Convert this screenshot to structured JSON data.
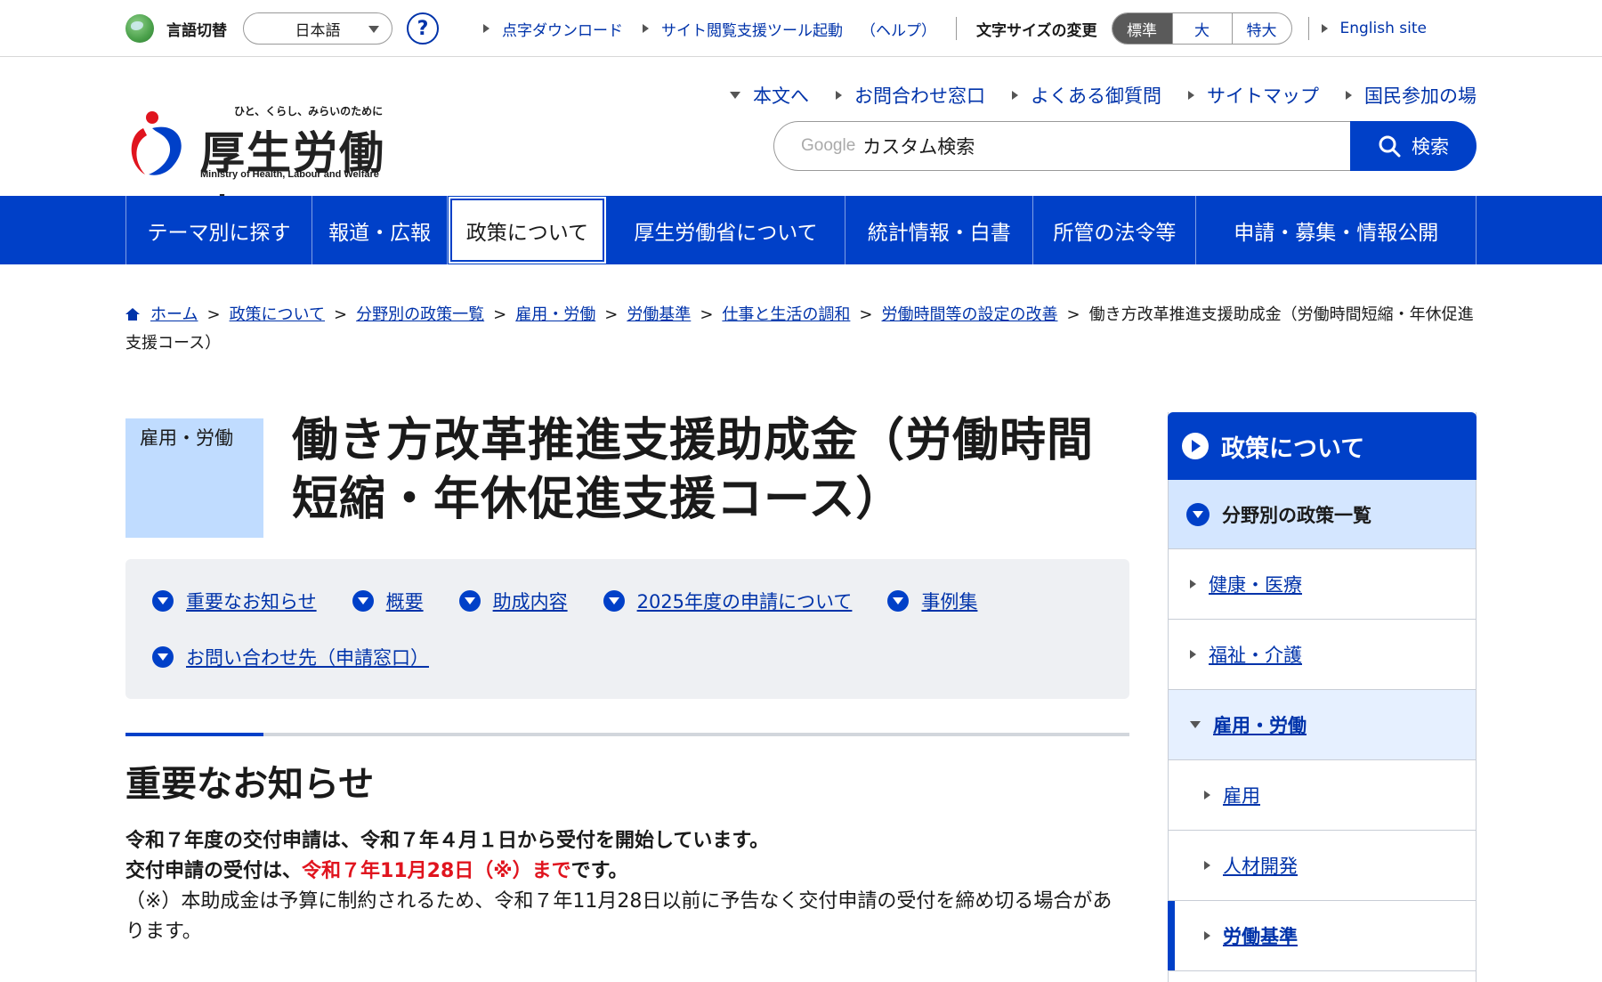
{
  "utility": {
    "lang_label": "言語切替",
    "lang_value": "日本語",
    "help": "?",
    "braille_link": "点字ダウンロード",
    "assist_tool_link": "サイト閲覧支援ツール起動",
    "help_link": "（ヘルプ）",
    "size_label": "文字サイズの変更",
    "sizes": [
      "標準",
      "大",
      "特大"
    ],
    "english": "English site"
  },
  "header": {
    "tagline": "ひと、くらし、みらいのために",
    "ministry": "厚生労働省",
    "ministry_en": "Ministry of Health, Labour and Welfare",
    "sub_nav": [
      "本文へ",
      "お問合わせ窓口",
      "よくある御質問",
      "サイトマップ",
      "国民参加の場"
    ],
    "search_brand": "Google",
    "search_placeholder": "カスタム検索",
    "search_button": "検索"
  },
  "global_nav": [
    "テーマ別に探す",
    "報道・広報",
    "政策について",
    "厚生労働省について",
    "統計情報・白書",
    "所管の法令等",
    "申請・募集・情報公開"
  ],
  "breadcrumb": {
    "items": [
      "ホーム",
      "政策について",
      "分野別の政策一覧",
      "雇用・労働",
      "労働基準",
      "仕事と生活の調和",
      "労働時間等の設定の改善"
    ],
    "current": "働き方改革推進支援助成金（労働時間短縮・年休促進支援コース）"
  },
  "main": {
    "category": "雇用・労働",
    "title": "働き方改革推進支援助成金（労働時間短縮・年休促進支援コース）",
    "toc": [
      "重要なお知らせ",
      "概要",
      "助成内容",
      "2025年度の申請について",
      "事例集",
      "お問い合わせ先（申請窓口）"
    ],
    "section_heading": "重要なお知らせ",
    "notice_line1": "令和７年度の交付申請は、令和７年４月１日から受付を開始しています。",
    "notice_line2_prefix": "交付申請の受付は、",
    "notice_line2_highlight": "令和７年11月28日（※）まで",
    "notice_line2_suffix": "です。",
    "notice_line3": "（※）本助成金は予算に制約されるため、令和７年11月28日以前に予告なく交付申請の受付を締め切る場合があります。"
  },
  "side_nav": {
    "header": "政策について",
    "level0": "分野別の政策一覧",
    "items": [
      "健康・医療",
      "福祉・介護",
      "雇用・労働"
    ],
    "subitems": [
      "雇用",
      "人材開発",
      "労働基準"
    ]
  },
  "colors": {
    "brand_blue": "#0040c8",
    "alert_red": "#e0141e",
    "category_bg": "#c0dcff"
  }
}
